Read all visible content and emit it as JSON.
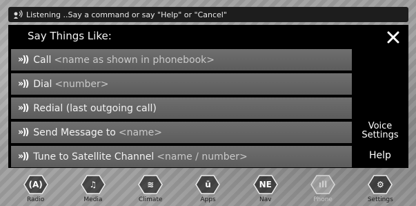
{
  "status": {
    "text": "Listening ..Say a command or say \"Help\" or \"Cancel\""
  },
  "panel": {
    "title": "Say Things Like:",
    "commands": [
      {
        "label": "Call",
        "hint": "<name as shown in phonebook>"
      },
      {
        "label": "Dial",
        "hint": "<number>"
      },
      {
        "label": "Redial (last outgoing call)",
        "hint": ""
      },
      {
        "label": "Send Message to",
        "hint": "<name>"
      },
      {
        "label": "Tune to Satellite Channel",
        "hint": "<name / number>"
      }
    ],
    "voice_settings_line1": "Voice",
    "voice_settings_line2": "Settings",
    "help": "Help"
  },
  "nav": [
    {
      "label": "Radio",
      "icon": "radio-icon"
    },
    {
      "label": "Media",
      "icon": "media-icon"
    },
    {
      "label": "Climate",
      "icon": "climate-icon"
    },
    {
      "label": "Apps",
      "icon": "apps-icon"
    },
    {
      "label": "Nav",
      "icon": "nav-icon",
      "glyph": "NE"
    },
    {
      "label": "Phone",
      "icon": "phone-icon",
      "state": "disabled"
    },
    {
      "label": "Settings",
      "icon": "settings-icon"
    }
  ],
  "colors": {
    "panel_bg": "#000000",
    "row_bg": "#666666",
    "hint_text": "#c9c9c9"
  }
}
